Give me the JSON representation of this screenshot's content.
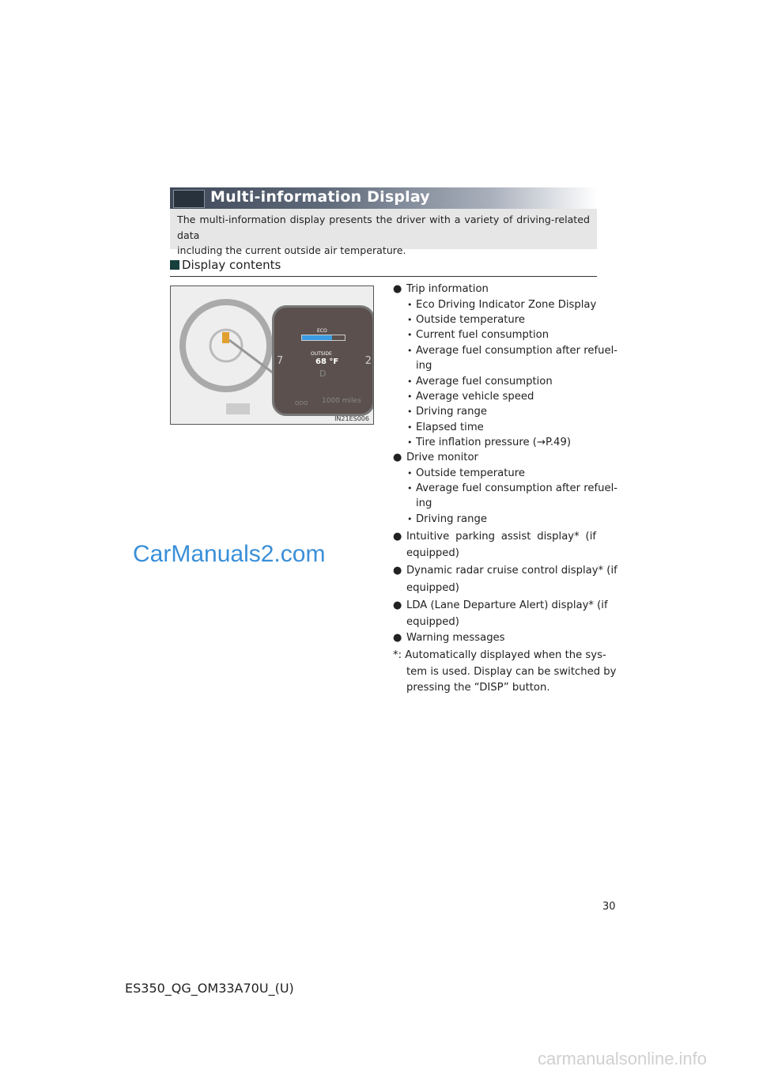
{
  "header": {
    "title": "Multi-information Display",
    "intro_line1": "The multi-information display presents the driver with a variety of driving-related data",
    "intro_line2": "including the current outside air temperature."
  },
  "section": {
    "title": "Display contents"
  },
  "figure": {
    "eco": "ECO",
    "outside": "OUTSIDE",
    "temp": "68 °F",
    "gear": "D",
    "odo": "ODO",
    "miles": "1000 miles",
    "left_num": "7",
    "right_num": "2",
    "eco_fill": 0.7,
    "caption": "IN21ES006"
  },
  "items": [
    {
      "label": "Trip information",
      "subs": [
        "Eco Driving Indicator Zone Display",
        "Outside temperature",
        "Current fuel consumption",
        "Average fuel consumption after refuel-",
        "ing",
        "Average fuel consumption",
        "Average vehicle speed",
        "Driving range",
        "Elapsed time",
        "Tire inflation pressure (→P.49)"
      ]
    },
    {
      "label": "Drive monitor",
      "subs": [
        "Outside temperature",
        "Average fuel consumption after refuel-",
        "ing",
        "Driving range"
      ]
    },
    {
      "label1": "Intuitive parking assist display* (if",
      "label2": "equipped)"
    },
    {
      "label1": "Dynamic radar cruise control display* (if",
      "label2": "equipped)"
    },
    {
      "label1": "LDA (Lane Departure Alert) display* (if",
      "label2": "equipped)"
    },
    {
      "label": "Warning messages"
    }
  ],
  "note": {
    "line1": "*: Automatically displayed when the sys-",
    "line2": "tem is used. Display can be switched by",
    "line3": "pressing the “DISP” button."
  },
  "watermark": "CarManuals2.com",
  "page_number": "30",
  "footer": "ES350_QG_OM33A70U_(U)",
  "site": "carmanualsonline.info"
}
